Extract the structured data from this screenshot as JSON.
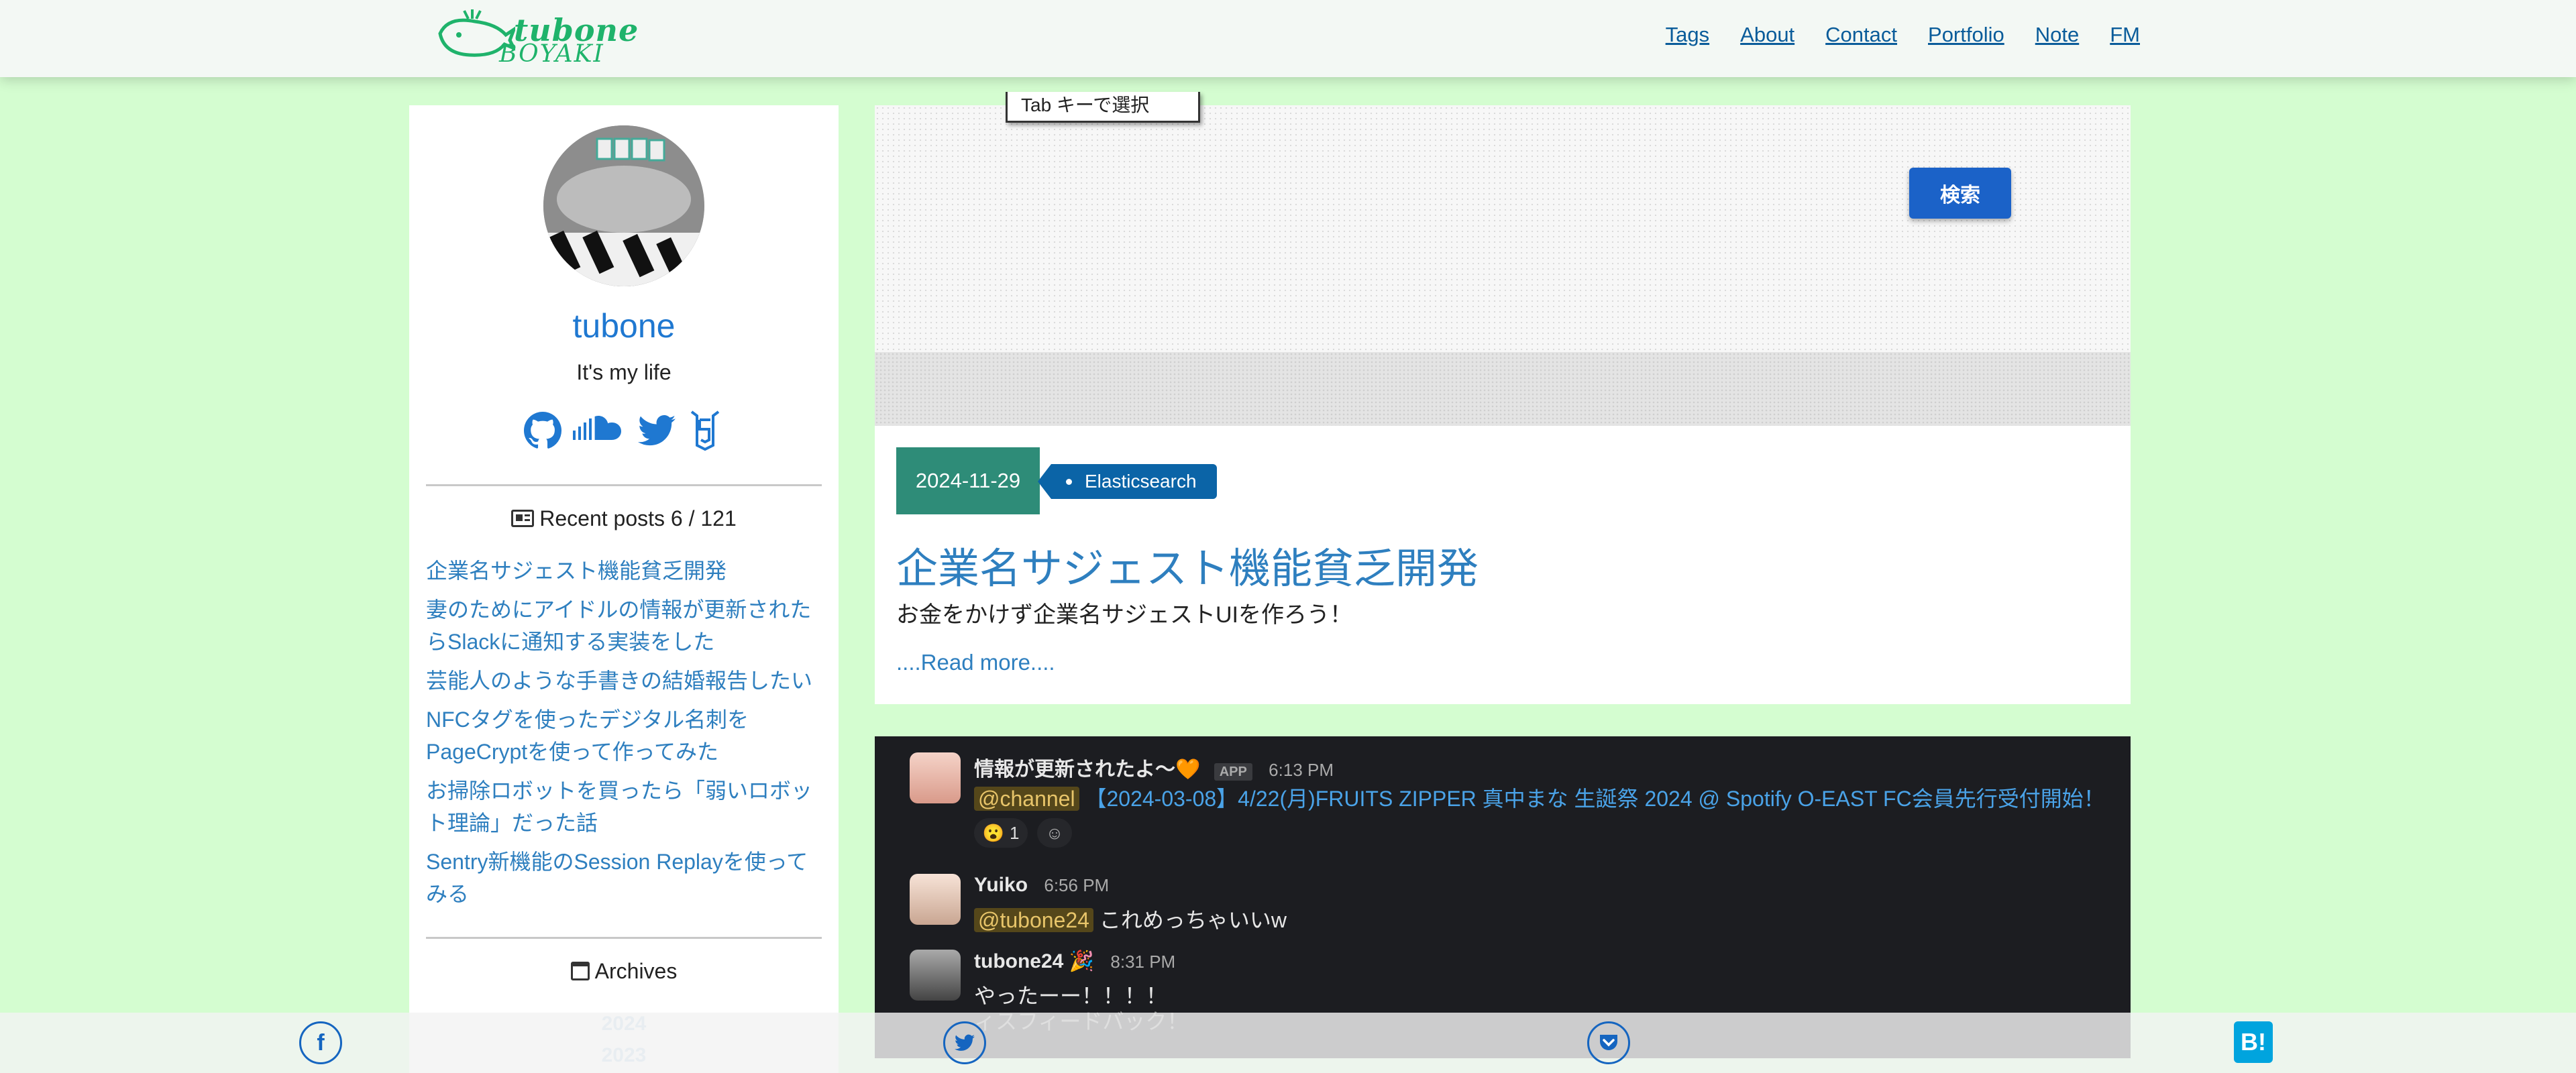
{
  "header": {
    "logo_text_top": "tubone",
    "logo_text_bottom": "BOYAKI",
    "nav": [
      "Tags",
      "About",
      "Contact",
      "Portfolio",
      "Note",
      "FM"
    ]
  },
  "profile": {
    "name": "tubone",
    "tagline": "It's my life",
    "social_icons": [
      "github-icon",
      "soundcloud-icon",
      "twitter-icon",
      "html5-icon"
    ]
  },
  "recent_posts": {
    "heading": "Recent posts  6 / 121",
    "items": [
      "企業名サジェスト機能貧乏開発",
      "妻のためにアイドルの情報が更新されたらSlackに通知する実装をした",
      "芸能人のような手書きの結婚報告したい",
      "NFCタグを使ったデジタル名刺をPageCryptを使って作ってみた",
      "お掃除ロボットを買ったら「弱いロボット理論」だった話",
      "Sentry新機能のSession Replayを使ってみる"
    ]
  },
  "archives": {
    "heading": "Archives",
    "years": [
      "2024",
      "2023"
    ]
  },
  "post1": {
    "screenshot_tab_text": "Tab キーで選択",
    "screenshot_button": "検索",
    "date": "2024-11-29",
    "tag": "Elasticsearch",
    "title": "企業名サジェスト機能貧乏開発",
    "description": "お金をかけず企業名サジェストUIを作ろう！",
    "read_more": "....Read more...."
  },
  "post2_screenshot": {
    "messages": [
      {
        "name": "情報が更新されたよ〜🧡",
        "badge": "APP",
        "time": "6:13 PM",
        "mention": "@channel",
        "text": "【2024-03-08】4/22(月)FRUITS ZIPPER 真中まな 生誕祭 2024 @ Spotify O-EAST FC会員先行受付開始！",
        "reaction": "1"
      },
      {
        "name": "Yuiko",
        "time": "6:56 PM",
        "mention": "@tubone24",
        "text": "これめっちゃいいw"
      },
      {
        "name": "tubone24 🎉",
        "time": "8:31 PM",
        "text": "やったーー！！！！"
      }
    ],
    "overflow_text": "ィスフィードバック！"
  },
  "share": {
    "hatena_label": "B!"
  },
  "colors": {
    "background": "#d4fdd0",
    "link": "#2e7fbf",
    "date_badge": "#2e8c78",
    "tag": "#0b64a7",
    "brand": "#1fb36b"
  }
}
